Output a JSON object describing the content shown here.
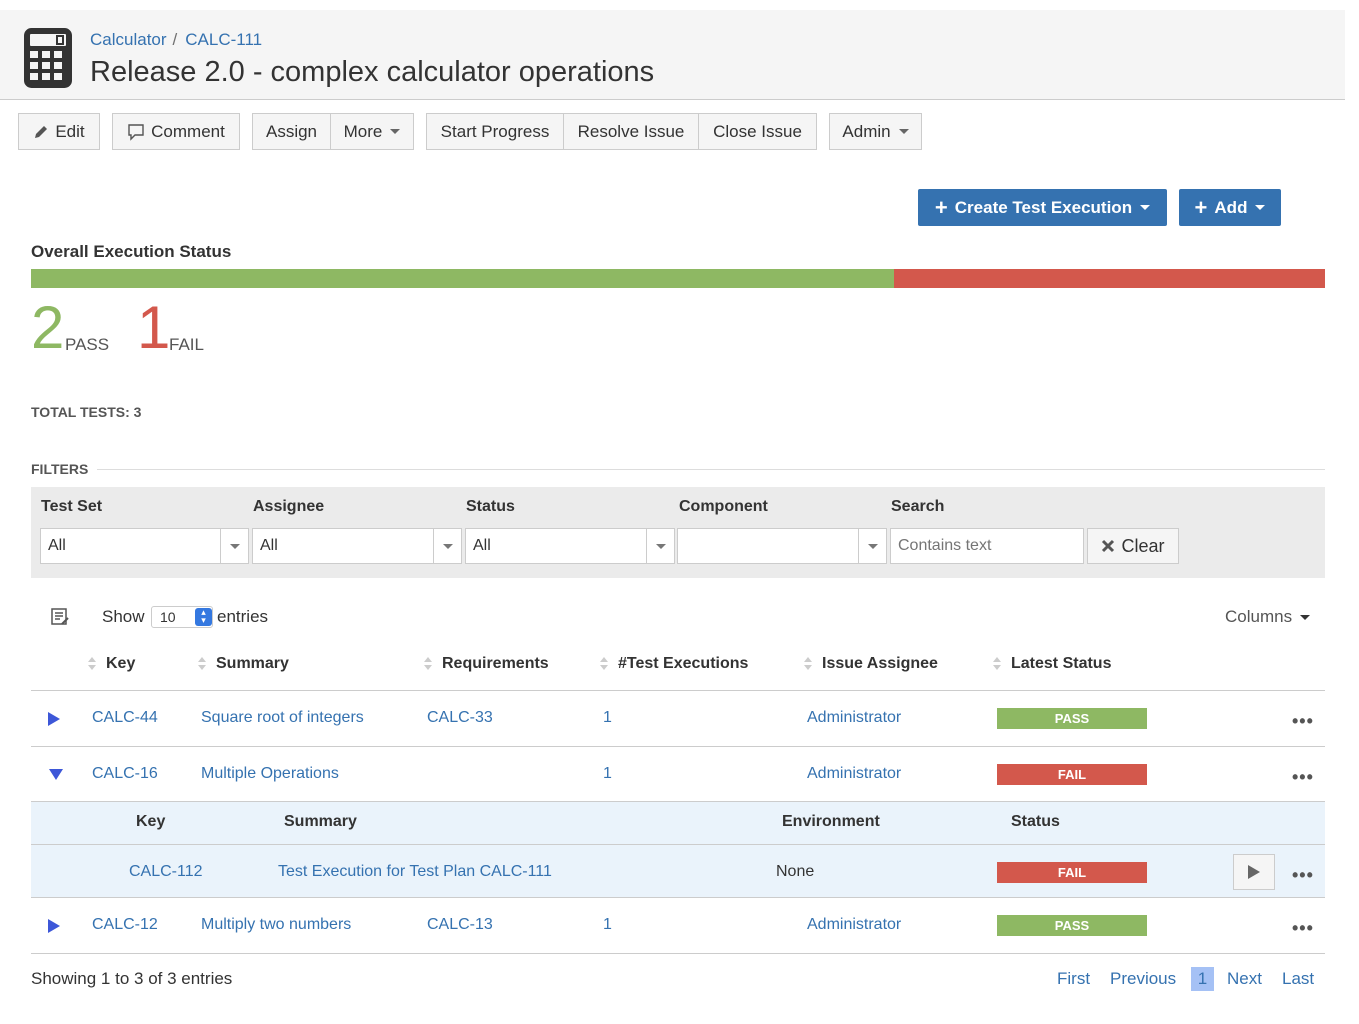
{
  "breadcrumb": {
    "project": "Calculator",
    "issue": "CALC-111"
  },
  "title": "Release 2.0 - complex calculator operations",
  "toolbar": {
    "edit": "Edit",
    "comment": "Comment",
    "assign": "Assign",
    "more": "More",
    "start_progress": "Start Progress",
    "resolve_issue": "Resolve Issue",
    "close_issue": "Close Issue",
    "admin": "Admin"
  },
  "actions": {
    "create_test_execution": "Create Test Execution",
    "add": "Add"
  },
  "overall": {
    "title": "Overall Execution Status",
    "pass_count": "2",
    "pass_label": "PASS",
    "fail_count": "1",
    "fail_label": "FAIL",
    "pass_fraction": 0.6667,
    "total_tests": "TOTAL TESTS: 3"
  },
  "colors": {
    "pass": "#8eb863",
    "fail": "#d3584c",
    "link": "#3572b0",
    "primary": "#3572b0"
  },
  "filters": {
    "label": "FILTERS",
    "test_set_label": "Test Set",
    "test_set_value": "All",
    "assignee_label": "Assignee",
    "assignee_value": "All",
    "status_label": "Status",
    "status_value": "All",
    "component_label": "Component",
    "component_value": "",
    "search_label": "Search",
    "search_placeholder": "Contains text",
    "clear": "Clear"
  },
  "table": {
    "show": "Show",
    "entries_value": "10",
    "entries": "entries",
    "columns": "Columns",
    "headers": [
      "Key",
      "Summary",
      "Requirements",
      "#Test Executions",
      "Issue Assignee",
      "Latest Status"
    ],
    "rows": [
      {
        "key": "CALC-44",
        "summary": "Square root of integers",
        "requirements": "CALC-33",
        "executions": "1",
        "assignee": "Administrator",
        "status": "PASS"
      },
      {
        "key": "CALC-16",
        "summary": "Multiple Operations",
        "requirements": "",
        "executions": "1",
        "assignee": "Administrator",
        "status": "FAIL"
      },
      {
        "key": "CALC-12",
        "summary": "Multiply two numbers",
        "requirements": "CALC-13",
        "executions": "1",
        "assignee": "Administrator",
        "status": "PASS"
      }
    ],
    "sub": {
      "headers": [
        "Key",
        "Summary",
        "Environment",
        "Status"
      ],
      "row": {
        "key": "CALC-112",
        "summary": "Test Execution for Test Plan CALC-111",
        "environment": "None",
        "status": "FAIL"
      }
    }
  },
  "footer": {
    "showing": "Showing 1 to 3 of 3 entries",
    "first": "First",
    "previous": "Previous",
    "current": "1",
    "next": "Next",
    "last": "Last"
  },
  "icons": [
    "calculator-icon",
    "pencil-icon",
    "comment-icon",
    "plus-icon",
    "close-icon",
    "table-settings-icon",
    "expand-icon",
    "collapse-icon",
    "play-icon",
    "more-icon"
  ]
}
